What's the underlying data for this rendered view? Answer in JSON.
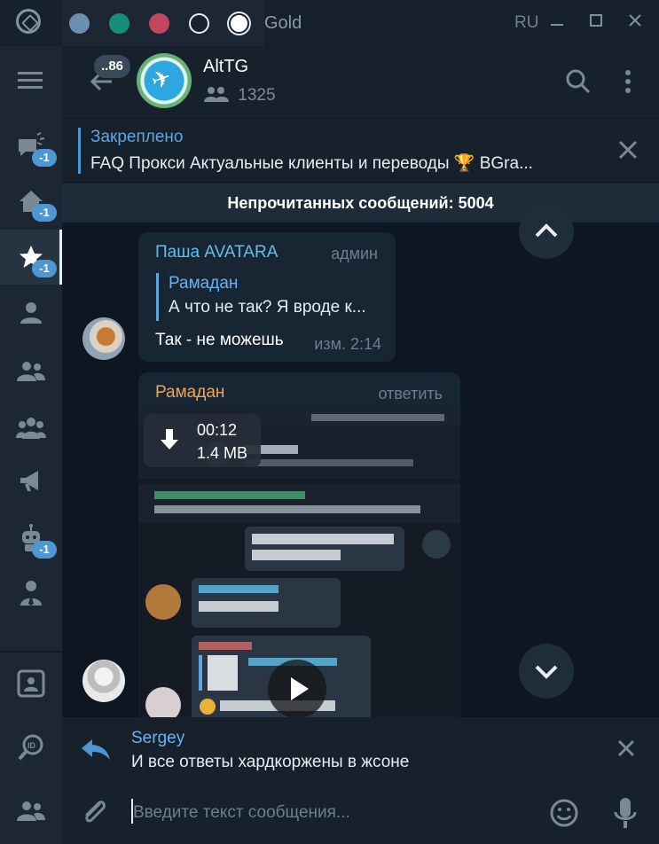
{
  "titlebar": {
    "title": "Gold",
    "lang": "RU",
    "dots": [
      "#6b8fb0",
      "#158f7b",
      "#c44562",
      "#1a222b",
      "#ffffff"
    ]
  },
  "rail": {
    "badges": [
      "-1",
      "-1",
      "-1",
      "-1"
    ]
  },
  "header": {
    "unread_count": "..86",
    "title": "AltTG",
    "members": "1325"
  },
  "pinned": {
    "title": "Закреплено",
    "text": "FAQ   Прокси   Актуальные клиенты и переводы  🏆 BGra..."
  },
  "unread_banner": "Непрочитанных сообщений: 5004",
  "messages": [
    {
      "author": "Паша AVATARA",
      "role": "админ",
      "reply_author": "Рамадан",
      "reply_text": "А что не так? Я вроде к...",
      "text": "Так - не можешь",
      "time": "изм. 2:14"
    },
    {
      "author": "Рамадан",
      "action": "ответить",
      "video_duration": "00:12",
      "video_size": "1.4 MB"
    }
  ],
  "reply_panel": {
    "author": "Sergey",
    "text": "И все ответы хардкоржены в жсоне"
  },
  "compose": {
    "placeholder": "Введите текст сообщения..."
  },
  "colors": {
    "accent": "#4e97d2",
    "bg": "#17212b",
    "chat_bg": "#0e1621"
  }
}
